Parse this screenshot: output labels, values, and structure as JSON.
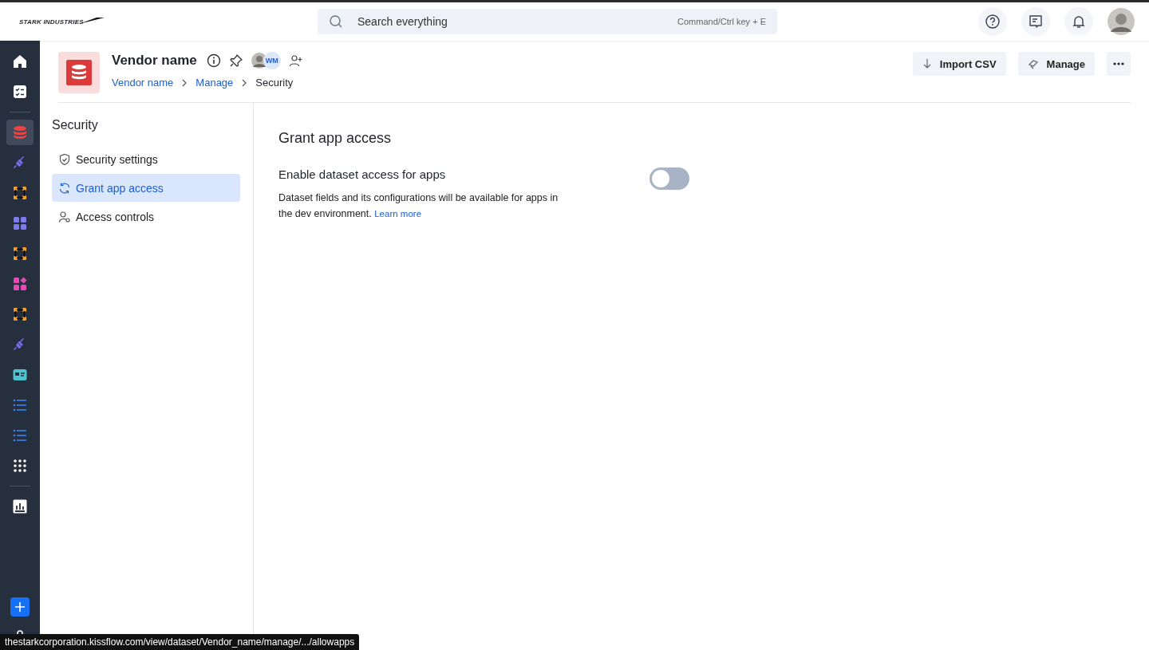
{
  "topbar": {
    "logo": "STARK INDUSTRIES",
    "search": {
      "placeholder": "Search everything",
      "shortcut": "Command/Ctrl key + E"
    }
  },
  "rail": {
    "groups": [
      [
        {
          "kind": "home",
          "selected": false
        },
        {
          "kind": "tasks",
          "selected": false
        }
      ],
      [
        {
          "kind": "database",
          "selected": true
        },
        {
          "kind": "plug",
          "selected": false
        },
        {
          "kind": "flow",
          "selected": false
        },
        {
          "kind": "grid",
          "selected": false
        },
        {
          "kind": "flow",
          "selected": false
        },
        {
          "kind": "shapes",
          "selected": false
        },
        {
          "kind": "flow",
          "selected": false
        },
        {
          "kind": "plug",
          "selected": false
        },
        {
          "kind": "card",
          "selected": false
        },
        {
          "kind": "list",
          "selected": false
        },
        {
          "kind": "list",
          "selected": false
        },
        {
          "kind": "apps",
          "selected": false
        }
      ],
      [
        {
          "kind": "chart",
          "selected": false
        }
      ]
    ],
    "bottom": [
      {
        "kind": "plus",
        "selected": false
      },
      {
        "kind": "bag",
        "selected": false
      }
    ]
  },
  "header": {
    "title": "Vendor name",
    "member_initials": "WM",
    "breadcrumbs": [
      {
        "label": "Vendor name",
        "link": true
      },
      {
        "label": "Manage",
        "link": true
      },
      {
        "label": "Security",
        "link": false
      }
    ],
    "actions": [
      {
        "kind": "import",
        "label": "Import CSV"
      },
      {
        "kind": "manage",
        "label": "Manage"
      },
      {
        "kind": "more"
      }
    ]
  },
  "section_nav": {
    "title": "Security",
    "items": [
      {
        "kind": "shield",
        "label": "Security settings",
        "selected": false
      },
      {
        "kind": "sync",
        "label": "Grant app access",
        "selected": true
      },
      {
        "kind": "user-gear",
        "label": "Access controls",
        "selected": false
      }
    ]
  },
  "content": {
    "title": "Grant app access",
    "setting": {
      "label": "Enable dataset access for apps",
      "description": "Dataset fields and its configurations will be available for apps in the dev environment.",
      "link": "Learn more",
      "on": false
    }
  },
  "status_bar": "thestarkcorporation.kissflow.com/view/dataset/Vendor_name/manage/.../allowapps"
}
